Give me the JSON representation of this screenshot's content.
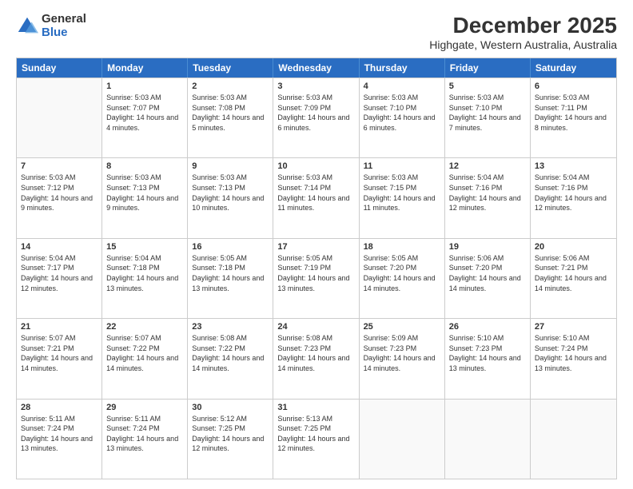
{
  "logo": {
    "general": "General",
    "blue": "Blue"
  },
  "header": {
    "title": "December 2025",
    "subtitle": "Highgate, Western Australia, Australia"
  },
  "weekdays": [
    "Sunday",
    "Monday",
    "Tuesday",
    "Wednesday",
    "Thursday",
    "Friday",
    "Saturday"
  ],
  "weeks": [
    [
      {
        "day": "",
        "empty": true
      },
      {
        "day": "1",
        "sunrise": "Sunrise: 5:03 AM",
        "sunset": "Sunset: 7:07 PM",
        "daylight": "Daylight: 14 hours and 4 minutes."
      },
      {
        "day": "2",
        "sunrise": "Sunrise: 5:03 AM",
        "sunset": "Sunset: 7:08 PM",
        "daylight": "Daylight: 14 hours and 5 minutes."
      },
      {
        "day": "3",
        "sunrise": "Sunrise: 5:03 AM",
        "sunset": "Sunset: 7:09 PM",
        "daylight": "Daylight: 14 hours and 6 minutes."
      },
      {
        "day": "4",
        "sunrise": "Sunrise: 5:03 AM",
        "sunset": "Sunset: 7:10 PM",
        "daylight": "Daylight: 14 hours and 6 minutes."
      },
      {
        "day": "5",
        "sunrise": "Sunrise: 5:03 AM",
        "sunset": "Sunset: 7:10 PM",
        "daylight": "Daylight: 14 hours and 7 minutes."
      },
      {
        "day": "6",
        "sunrise": "Sunrise: 5:03 AM",
        "sunset": "Sunset: 7:11 PM",
        "daylight": "Daylight: 14 hours and 8 minutes."
      }
    ],
    [
      {
        "day": "7",
        "sunrise": "Sunrise: 5:03 AM",
        "sunset": "Sunset: 7:12 PM",
        "daylight": "Daylight: 14 hours and 9 minutes."
      },
      {
        "day": "8",
        "sunrise": "Sunrise: 5:03 AM",
        "sunset": "Sunset: 7:13 PM",
        "daylight": "Daylight: 14 hours and 9 minutes."
      },
      {
        "day": "9",
        "sunrise": "Sunrise: 5:03 AM",
        "sunset": "Sunset: 7:13 PM",
        "daylight": "Daylight: 14 hours and 10 minutes."
      },
      {
        "day": "10",
        "sunrise": "Sunrise: 5:03 AM",
        "sunset": "Sunset: 7:14 PM",
        "daylight": "Daylight: 14 hours and 11 minutes."
      },
      {
        "day": "11",
        "sunrise": "Sunrise: 5:03 AM",
        "sunset": "Sunset: 7:15 PM",
        "daylight": "Daylight: 14 hours and 11 minutes."
      },
      {
        "day": "12",
        "sunrise": "Sunrise: 5:04 AM",
        "sunset": "Sunset: 7:16 PM",
        "daylight": "Daylight: 14 hours and 12 minutes."
      },
      {
        "day": "13",
        "sunrise": "Sunrise: 5:04 AM",
        "sunset": "Sunset: 7:16 PM",
        "daylight": "Daylight: 14 hours and 12 minutes."
      }
    ],
    [
      {
        "day": "14",
        "sunrise": "Sunrise: 5:04 AM",
        "sunset": "Sunset: 7:17 PM",
        "daylight": "Daylight: 14 hours and 12 minutes."
      },
      {
        "day": "15",
        "sunrise": "Sunrise: 5:04 AM",
        "sunset": "Sunset: 7:18 PM",
        "daylight": "Daylight: 14 hours and 13 minutes."
      },
      {
        "day": "16",
        "sunrise": "Sunrise: 5:05 AM",
        "sunset": "Sunset: 7:18 PM",
        "daylight": "Daylight: 14 hours and 13 minutes."
      },
      {
        "day": "17",
        "sunrise": "Sunrise: 5:05 AM",
        "sunset": "Sunset: 7:19 PM",
        "daylight": "Daylight: 14 hours and 13 minutes."
      },
      {
        "day": "18",
        "sunrise": "Sunrise: 5:05 AM",
        "sunset": "Sunset: 7:20 PM",
        "daylight": "Daylight: 14 hours and 14 minutes."
      },
      {
        "day": "19",
        "sunrise": "Sunrise: 5:06 AM",
        "sunset": "Sunset: 7:20 PM",
        "daylight": "Daylight: 14 hours and 14 minutes."
      },
      {
        "day": "20",
        "sunrise": "Sunrise: 5:06 AM",
        "sunset": "Sunset: 7:21 PM",
        "daylight": "Daylight: 14 hours and 14 minutes."
      }
    ],
    [
      {
        "day": "21",
        "sunrise": "Sunrise: 5:07 AM",
        "sunset": "Sunset: 7:21 PM",
        "daylight": "Daylight: 14 hours and 14 minutes."
      },
      {
        "day": "22",
        "sunrise": "Sunrise: 5:07 AM",
        "sunset": "Sunset: 7:22 PM",
        "daylight": "Daylight: 14 hours and 14 minutes."
      },
      {
        "day": "23",
        "sunrise": "Sunrise: 5:08 AM",
        "sunset": "Sunset: 7:22 PM",
        "daylight": "Daylight: 14 hours and 14 minutes."
      },
      {
        "day": "24",
        "sunrise": "Sunrise: 5:08 AM",
        "sunset": "Sunset: 7:23 PM",
        "daylight": "Daylight: 14 hours and 14 minutes."
      },
      {
        "day": "25",
        "sunrise": "Sunrise: 5:09 AM",
        "sunset": "Sunset: 7:23 PM",
        "daylight": "Daylight: 14 hours and 14 minutes."
      },
      {
        "day": "26",
        "sunrise": "Sunrise: 5:10 AM",
        "sunset": "Sunset: 7:23 PM",
        "daylight": "Daylight: 14 hours and 13 minutes."
      },
      {
        "day": "27",
        "sunrise": "Sunrise: 5:10 AM",
        "sunset": "Sunset: 7:24 PM",
        "daylight": "Daylight: 14 hours and 13 minutes."
      }
    ],
    [
      {
        "day": "28",
        "sunrise": "Sunrise: 5:11 AM",
        "sunset": "Sunset: 7:24 PM",
        "daylight": "Daylight: 14 hours and 13 minutes."
      },
      {
        "day": "29",
        "sunrise": "Sunrise: 5:11 AM",
        "sunset": "Sunset: 7:24 PM",
        "daylight": "Daylight: 14 hours and 13 minutes."
      },
      {
        "day": "30",
        "sunrise": "Sunrise: 5:12 AM",
        "sunset": "Sunset: 7:25 PM",
        "daylight": "Daylight: 14 hours and 12 minutes."
      },
      {
        "day": "31",
        "sunrise": "Sunrise: 5:13 AM",
        "sunset": "Sunset: 7:25 PM",
        "daylight": "Daylight: 14 hours and 12 minutes."
      },
      {
        "day": "",
        "empty": true
      },
      {
        "day": "",
        "empty": true
      },
      {
        "day": "",
        "empty": true
      }
    ]
  ]
}
